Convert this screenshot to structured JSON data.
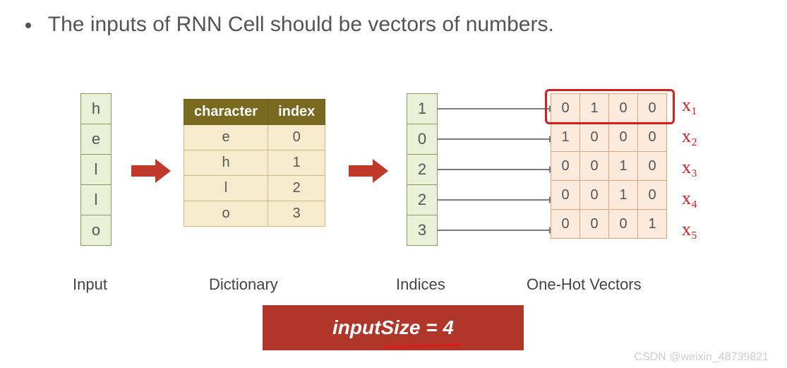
{
  "title": "The inputs of RNN Cell should be vectors of numbers.",
  "labels": {
    "input": "Input",
    "dictionary": "Dictionary",
    "indices": "Indices",
    "onehot": "One-Hot Vectors"
  },
  "input_chars": [
    "h",
    "e",
    "l",
    "l",
    "o"
  ],
  "dictionary": {
    "headers": {
      "character": "character",
      "index": "index"
    },
    "rows": [
      {
        "char": "e",
        "idx": "0"
      },
      {
        "char": "h",
        "idx": "1"
      },
      {
        "char": "l",
        "idx": "2"
      },
      {
        "char": "o",
        "idx": "3"
      }
    ]
  },
  "indices": [
    "1",
    "0",
    "2",
    "2",
    "3"
  ],
  "onehot": [
    [
      "0",
      "1",
      "0",
      "0"
    ],
    [
      "1",
      "0",
      "0",
      "0"
    ],
    [
      "0",
      "0",
      "1",
      "0"
    ],
    [
      "0",
      "0",
      "1",
      "0"
    ],
    [
      "0",
      "0",
      "0",
      "1"
    ]
  ],
  "annotations": [
    "x₁",
    "x₂",
    "x₃",
    "x₄",
    "x₅"
  ],
  "banner": "inputSize = 4",
  "watermark": "CSDN @weixin_48739821"
}
